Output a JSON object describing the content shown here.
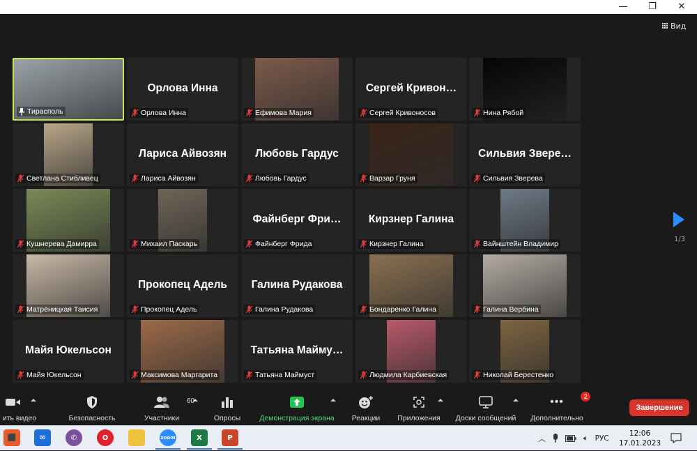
{
  "window": {
    "minimize": "—",
    "restore": "❐",
    "close": "✕"
  },
  "view": {
    "label": "Вид"
  },
  "tiles": [
    {
      "label": "Тирасполь",
      "big": "",
      "video": true,
      "active": true,
      "pinned": true,
      "muted": false
    },
    {
      "label": "Орлова Инна",
      "big": "Орлова Инна",
      "video": false,
      "muted": true
    },
    {
      "label": "Ефимова Мария",
      "big": "",
      "video": true,
      "muted": true
    },
    {
      "label": "Сергей Кривоносов",
      "big": "Сергей Кривон…",
      "video": false,
      "muted": true
    },
    {
      "label": "Нина Рябой",
      "big": "",
      "video": true,
      "muted": true
    },
    {
      "label": "Светлана Стибливец",
      "big": "",
      "video": true,
      "muted": true
    },
    {
      "label": "Лариса Айвозян",
      "big": "Лариса Айвозян",
      "video": false,
      "muted": true
    },
    {
      "label": "Любовь Гардус",
      "big": "Любовь Гардус",
      "video": false,
      "muted": true
    },
    {
      "label": "Варзар Груня",
      "big": "",
      "video": true,
      "muted": true
    },
    {
      "label": "Сильвия Зверева",
      "big": "Сильвия Звере…",
      "video": false,
      "muted": true
    },
    {
      "label": "Кушнерева Дамирра",
      "big": "",
      "video": true,
      "muted": true
    },
    {
      "label": "Михаил Паскарь",
      "big": "",
      "video": true,
      "muted": true
    },
    {
      "label": "Файнберг Фрида",
      "big": "Файнберг Фри…",
      "video": false,
      "muted": true
    },
    {
      "label": "Кирзнер Галина",
      "big": "Кирзнер Галина",
      "video": false,
      "muted": true
    },
    {
      "label": "Вайнштейн Владимир",
      "big": "",
      "video": true,
      "muted": true
    },
    {
      "label": "Матрёницкая Таисия",
      "big": "",
      "video": true,
      "muted": true
    },
    {
      "label": "Прокопец Адель",
      "big": "Прокопец Адель",
      "video": false,
      "muted": true
    },
    {
      "label": "Галина Рудакова",
      "big": "Галина Рудакова",
      "video": false,
      "muted": true
    },
    {
      "label": "Бондаренко Галина",
      "big": "",
      "video": true,
      "muted": true
    },
    {
      "label": "Галина Вербина",
      "big": "",
      "video": true,
      "muted": true
    },
    {
      "label": "Майя Юкельсон",
      "big": "Майя Юкельсон",
      "video": false,
      "muted": true
    },
    {
      "label": "Максимова Маргарита",
      "big": "",
      "video": true,
      "muted": true
    },
    {
      "label": "Татьяна Маймуст",
      "big": "Татьяна Майму…",
      "video": false,
      "muted": true
    },
    {
      "label": "Людмила Карбиевская",
      "big": "",
      "video": true,
      "muted": true
    },
    {
      "label": "Николай Берестенко",
      "big": "",
      "video": true,
      "muted": true
    }
  ],
  "pagination": {
    "label": "1/3"
  },
  "toolbar": {
    "video": "ить видео",
    "security": "Безопасность",
    "participants": "Участники",
    "participants_count": "60",
    "polls": "Опросы",
    "share": "Демонстрация экрана",
    "reactions": "Реакции",
    "apps": "Приложения",
    "whiteboards": "Доски сообщений",
    "more": "Дополнительно",
    "more_badge": "2",
    "end": "Завершение"
  },
  "taskbar": {
    "apps": [
      "office-icon",
      "mail-icon",
      "viber-icon",
      "opera-icon",
      "explorer-icon",
      "zoom-icon",
      "excel-icon",
      "powerpoint-icon"
    ],
    "zoom_label": "zoom",
    "excel_label": "X",
    "ppt_label": "P",
    "lang": "РУС",
    "time": "12:06",
    "date": "17.01.2023"
  },
  "colors": {
    "accent": "#2d8cff",
    "active_border": "#c6e84a",
    "share_green": "#23c552",
    "end_red": "#d9342b"
  }
}
